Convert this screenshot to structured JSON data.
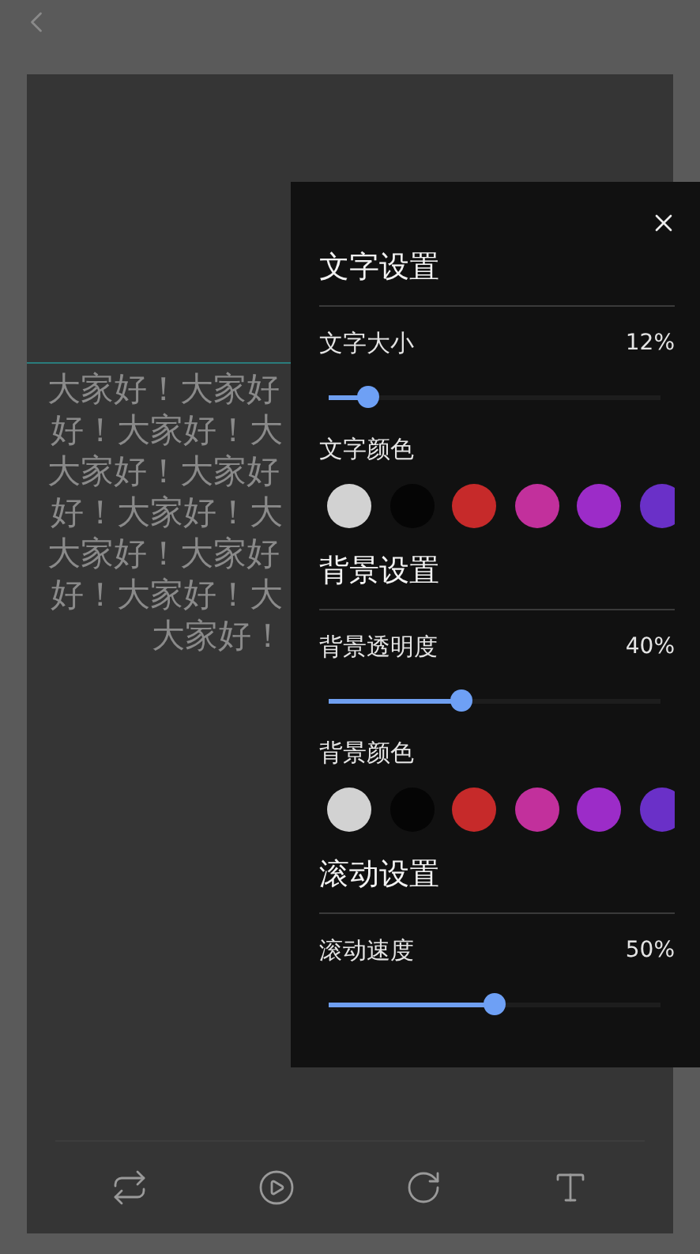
{
  "preview": {
    "lines": [
      "大家好！大家好",
      "好！大家好！大",
      "大家好！大家好",
      "好！大家好！大",
      "大家好！大家好",
      "好！大家好！大",
      "大家好！"
    ]
  },
  "settings_panel": {
    "sections": [
      {
        "title": "文字设置",
        "rows": [
          {
            "kind": "slider",
            "label": "文字大小",
            "value": "12%",
            "level": 0.12
          },
          {
            "kind": "colors",
            "label": "文字颜色",
            "swatches": [
              {
                "color": "#d2d2d2"
              },
              {
                "color": "#050505"
              },
              {
                "color": "#c62a2a"
              },
              {
                "color": "#c2309c"
              },
              {
                "color": "#9c2cc8"
              },
              {
                "color": "#6a30c8"
              }
            ]
          }
        ]
      },
      {
        "title": "背景设置",
        "rows": [
          {
            "kind": "slider",
            "label": "背景透明度",
            "value": "40%",
            "level": 0.4
          },
          {
            "kind": "colors",
            "label": "背景颜色",
            "swatches": [
              {
                "color": "#d2d2d2"
              },
              {
                "color": "#050505"
              },
              {
                "color": "#c62a2a"
              },
              {
                "color": "#c2309c"
              },
              {
                "color": "#9c2cc8"
              },
              {
                "color": "#6a30c8"
              }
            ]
          }
        ]
      },
      {
        "title": "滚动设置",
        "rows": [
          {
            "kind": "slider",
            "label": "滚动速度",
            "value": "50%",
            "level": 0.5
          }
        ]
      }
    ]
  },
  "toolbar": [
    {
      "kind": "repeat"
    },
    {
      "kind": "play"
    },
    {
      "kind": "rotate"
    },
    {
      "kind": "text"
    }
  ]
}
